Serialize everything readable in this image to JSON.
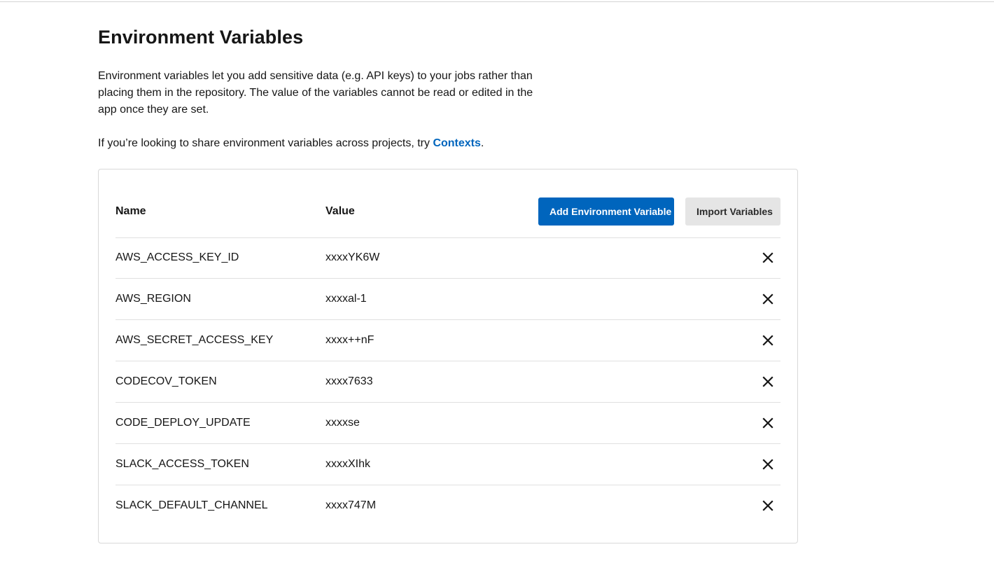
{
  "page": {
    "title": "Environment Variables",
    "description": "Environment variables let you add sensitive data (e.g. API keys) to your jobs rather than placing them in the repository. The value of the variables cannot be read or edited in the app once they are set.",
    "share_prefix": "If you’re looking to share environment variables across projects, try ",
    "share_link": "Contexts",
    "share_suffix": "."
  },
  "table": {
    "name_header": "Name",
    "value_header": "Value",
    "add_button": "Add Environment Variable",
    "import_button": "Import Variables",
    "delete_icon": "close-icon",
    "rows": [
      {
        "name": "AWS_ACCESS_KEY_ID",
        "value": "xxxxYK6W"
      },
      {
        "name": "AWS_REGION",
        "value": "xxxxal-1"
      },
      {
        "name": "AWS_SECRET_ACCESS_KEY",
        "value": "xxxx++nF"
      },
      {
        "name": "CODECOV_TOKEN",
        "value": "xxxx7633"
      },
      {
        "name": "CODE_DEPLOY_UPDATE",
        "value": "xxxxse"
      },
      {
        "name": "SLACK_ACCESS_TOKEN",
        "value": "xxxxXIhk"
      },
      {
        "name": "SLACK_DEFAULT_CHANNEL",
        "value": "xxxx747M"
      }
    ]
  },
  "colors": {
    "primary": "#0065bd",
    "link": "#0065bd",
    "secondary_button_bg": "#e5e5e5"
  }
}
